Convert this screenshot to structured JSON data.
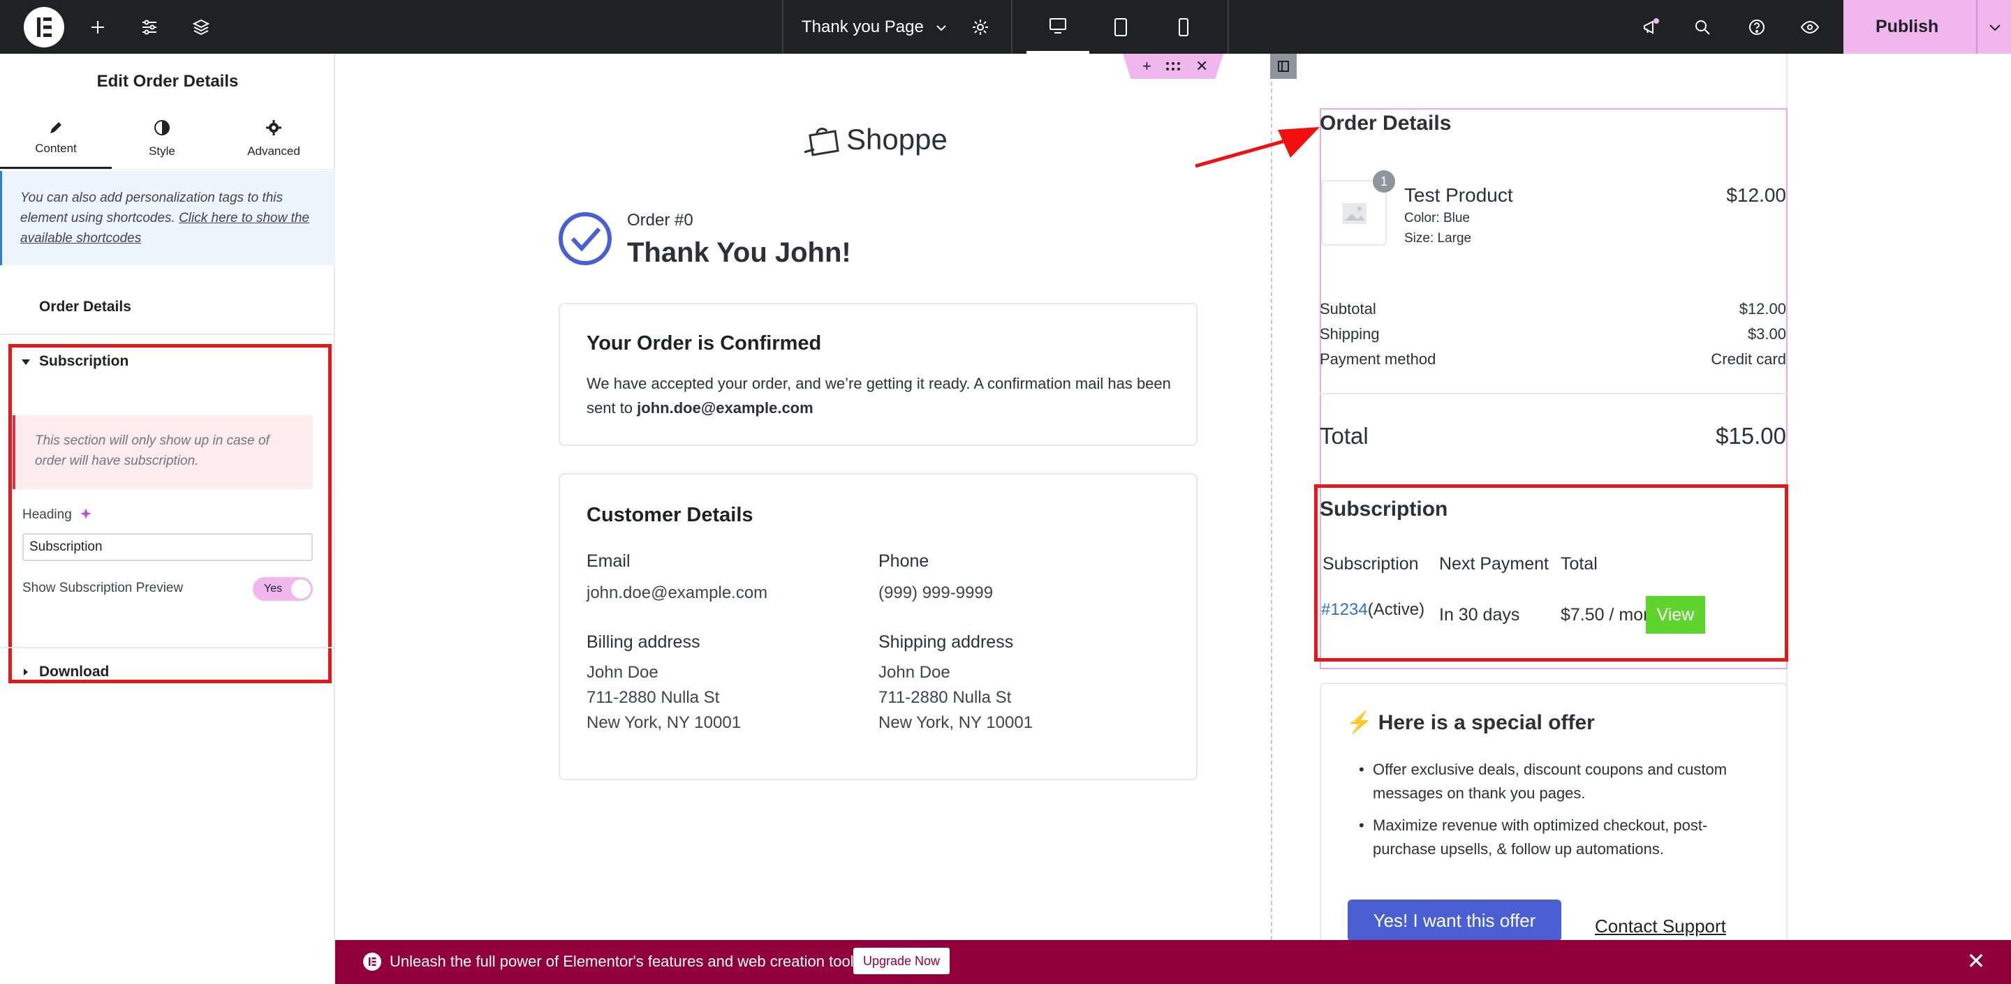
{
  "topbar": {
    "page_title": "Thank you Page",
    "publish_label": "Publish"
  },
  "panel": {
    "title": "Edit Order Details",
    "tabs": [
      {
        "label": "Content"
      },
      {
        "label": "Style"
      },
      {
        "label": "Advanced"
      }
    ],
    "notice_text": "You can also add personalization tags to this element using shortcodes.",
    "notice_link": "Click here to show the available shortcodes",
    "sections": {
      "order_details": "Order Details",
      "subscription": "Subscription",
      "download": "Download"
    },
    "subscription_notice": "This section will only show up in case of order will have subscription.",
    "heading_label": "Heading",
    "heading_value": "Subscription",
    "toggle_label": "Show Subscription Preview",
    "toggle_value": "Yes"
  },
  "page": {
    "brand": "Shoppe",
    "order_no": "Order #0",
    "thank_you": "Thank You John!",
    "confirmed_title": "Your Order is Confirmed",
    "confirmed_text": "We have accepted your order, and we’re getting it ready. A confirmation mail has been sent to",
    "confirmed_email": "john.doe@example.com",
    "customer_title": "Customer Details",
    "email_label": "Email",
    "email_value": "john.doe@example.com",
    "phone_label": "Phone",
    "phone_value": "(999) 999-9999",
    "billing_label": "Billing address",
    "billing_lines": [
      "John Doe",
      "711-2880 Nulla St",
      "New York, NY 10001"
    ],
    "shipping_label": "Shipping address",
    "shipping_lines": [
      "John Doe",
      "711-2880 Nulla St",
      "New York, NY 10001"
    ]
  },
  "order": {
    "title": "Order Details",
    "product_qty": "1",
    "product_name": "Test Product",
    "product_color": "Color: Blue",
    "product_size": "Size: Large",
    "product_price": "$12.00",
    "subtotal_label": "Subtotal",
    "subtotal_value": "$12.00",
    "shipping_label": "Shipping",
    "shipping_value": "$3.00",
    "payment_label": "Payment method",
    "payment_value": "Credit card",
    "total_label": "Total",
    "total_value": "$15.00"
  },
  "subscription": {
    "title": "Subscription",
    "col_subscription": "Subscription",
    "col_next": "Next Payment",
    "col_total": "Total",
    "id_link": "#1234",
    "status": "(Active)",
    "next_payment": "In 30 days",
    "total": "$7.50 / month",
    "view_label": "View"
  },
  "offer": {
    "icon": "⚡",
    "title": "Here is a special offer",
    "bullets": [
      "Offer exclusive deals, discount coupons and custom messages on thank you pages.",
      "Maximize revenue with optimized checkout, post-purchase upsells, & follow up automations."
    ],
    "cta": "Yes! I want this offer",
    "contact": "Contact Support"
  },
  "banner": {
    "text": "Unleash the full power of Elementor's features and web creation tools.",
    "upgrade": "Upgrade Now"
  },
  "colors": {
    "accent": "#f0b7ee",
    "banner": "#92003b",
    "highlight_red": "#e31818",
    "view_green": "#5fd42d",
    "offer_button": "#4a5fd2"
  }
}
